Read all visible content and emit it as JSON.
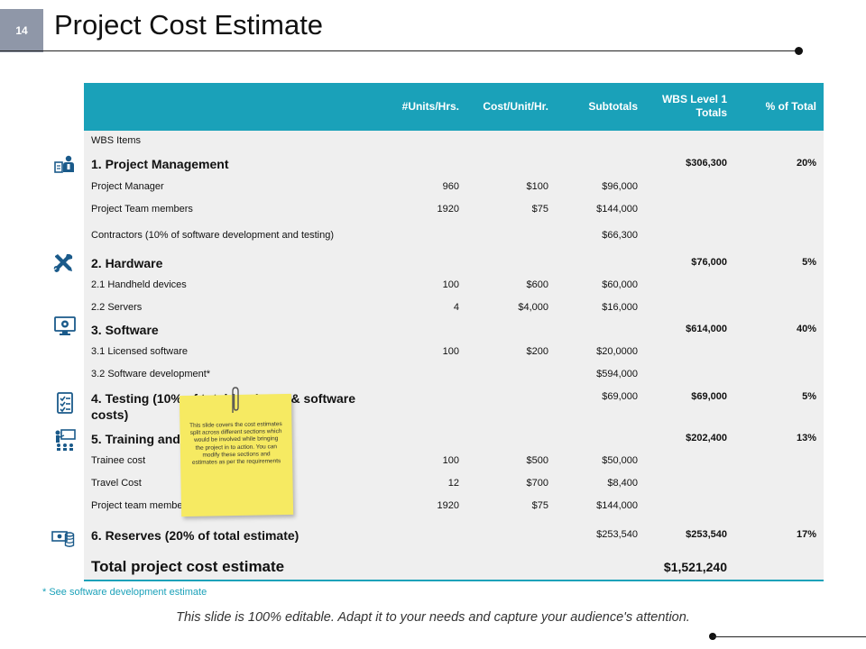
{
  "slide": {
    "number": "14",
    "title": "Project Cost Estimate"
  },
  "table": {
    "headers": {
      "units": "#Units/Hrs.",
      "cost": "Cost/Unit/Hr.",
      "subtotals": "Subtotals",
      "wbs_line1": "WBS Level 1",
      "wbs_line2": "Totals",
      "pct": "% of Total"
    },
    "rows": [
      {
        "label": "WBS Items",
        "units": "",
        "cost": "",
        "subtotal": "",
        "wbs": "",
        "pct": ""
      },
      {
        "label": "1. Project Management",
        "units": "",
        "cost": "",
        "subtotal": "",
        "wbs": "$306,300",
        "pct": "20%"
      },
      {
        "label": "Project Manager",
        "units": "960",
        "cost": "$100",
        "subtotal": "$96,000",
        "wbs": "",
        "pct": ""
      },
      {
        "label": "Project Team members",
        "units": "1920",
        "cost": "$75",
        "subtotal": "$144,000",
        "wbs": "",
        "pct": ""
      },
      {
        "label": "Contractors (10% of software development and testing)",
        "units": "",
        "cost": "",
        "subtotal": "$66,300",
        "wbs": "",
        "pct": ""
      },
      {
        "label": "2. Hardware",
        "units": "",
        "cost": "",
        "subtotal": "",
        "wbs": "$76,000",
        "pct": "5%"
      },
      {
        "label": "2.1 Handheld devices",
        "units": "100",
        "cost": "$600",
        "subtotal": "$60,000",
        "wbs": "",
        "pct": ""
      },
      {
        "label": "2.2 Servers",
        "units": "4",
        "cost": "$4,000",
        "subtotal": "$16,000",
        "wbs": "",
        "pct": ""
      },
      {
        "label": "3. Software",
        "units": "",
        "cost": "",
        "subtotal": "",
        "wbs": "$614,000",
        "pct": "40%"
      },
      {
        "label": "3.1 Licensed software",
        "units": "100",
        "cost": "$200",
        "subtotal": "$20,0000",
        "wbs": "",
        "pct": ""
      },
      {
        "label": "3.2 Software development*",
        "units": "",
        "cost": "",
        "subtotal": "$594,000",
        "wbs": "",
        "pct": ""
      },
      {
        "label_line1": "4. Testing (10% of total hardware & software",
        "label_line2": "costs)",
        "units": "",
        "cost": "",
        "subtotal": "$69,000",
        "wbs": "$69,000",
        "pct": "5%"
      },
      {
        "label": "5. Training and Travel",
        "units": "",
        "cost": "",
        "subtotal": "",
        "wbs": "$202,400",
        "pct": "13%"
      },
      {
        "label": "Trainee cost",
        "units": "100",
        "cost": "$500",
        "subtotal": "$50,000",
        "wbs": "",
        "pct": ""
      },
      {
        "label": "Travel Cost",
        "units": "12",
        "cost": "$700",
        "subtotal": "$8,400",
        "wbs": "",
        "pct": ""
      },
      {
        "label": "Project team members",
        "units": "1920",
        "cost": "$75",
        "subtotal": "$144,000",
        "wbs": "",
        "pct": ""
      },
      {
        "label": "6. Reserves (20% of total estimate)",
        "units": "",
        "cost": "",
        "subtotal": "$253,540",
        "wbs": "$253,540",
        "pct": "17%"
      }
    ],
    "total": {
      "label": "Total project cost estimate",
      "value": "$1,521,240"
    }
  },
  "sticky_note": {
    "text": "This slide covers the cost estimates split across different sections which would be involved while bringing the project in to action. You can modify these sections and estimates as per the requirements"
  },
  "footnote": "* See software development estimate",
  "bottom_caption": "This slide is 100% editable. Adapt it to your needs and capture your audience's attention.",
  "icons": [
    "management-icon",
    "tools-icon",
    "software-icon",
    "checklist-icon",
    "training-icon",
    "money-icon"
  ],
  "colors": {
    "accent": "#1aa1b9",
    "table_bg": "#efefef",
    "slide_number_bg": "#8f97a8",
    "sticky_note": "#f6ea62"
  }
}
